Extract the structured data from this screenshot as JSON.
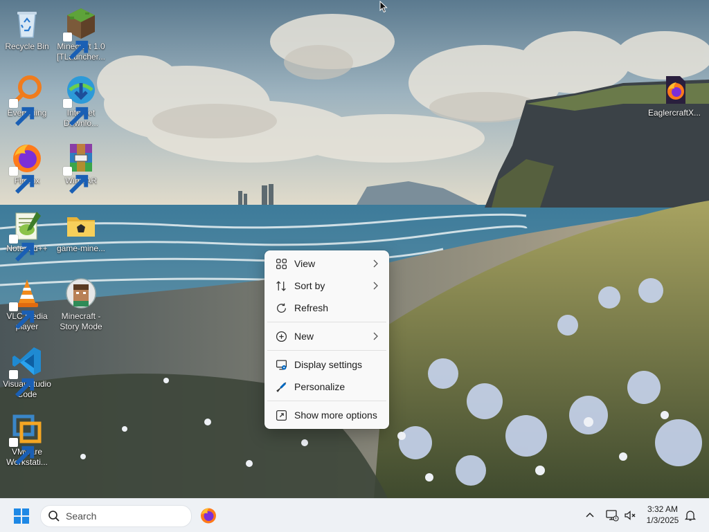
{
  "desktop": {
    "icons": [
      {
        "label": "Recycle Bin",
        "icon": "recycle-bin-icon"
      },
      {
        "label": "Minecraft 1.0 [TLauncher...",
        "icon": "minecraft-icon"
      },
      {
        "label": "Everything",
        "icon": "everything-search-icon"
      },
      {
        "label": "Internet Downlo...",
        "icon": "internet-download-manager-icon"
      },
      {
        "label": "Firefox",
        "icon": "firefox-icon"
      },
      {
        "label": "WinRAR",
        "icon": "winrar-icon"
      },
      {
        "label": "Notepad++",
        "icon": "notepad-plus-plus-icon"
      },
      {
        "label": "game-mine...",
        "icon": "folder-icon"
      },
      {
        "label": "VLC media player",
        "icon": "vlc-icon"
      },
      {
        "label": "Minecraft - Story Mode",
        "icon": "minecraft-story-mode-icon"
      },
      {
        "label": "Visual Studio Code",
        "icon": "vscode-icon"
      },
      {
        "label": "VMware Workstati...",
        "icon": "vmware-icon"
      },
      {
        "label": "EaglercraftX...",
        "icon": "eaglercraft-firefox-icon"
      }
    ]
  },
  "context_menu": {
    "view": "View",
    "sort_by": "Sort by",
    "refresh": "Refresh",
    "new": "New",
    "display_settings": "Display settings",
    "personalize": "Personalize",
    "show_more_options": "Show more options"
  },
  "taskbar": {
    "search_placeholder": "Search",
    "time": "3:32 AM",
    "date": "1/3/2025"
  },
  "colors": {
    "accent": "#0067c0",
    "taskbar_bg": "#eef1f5",
    "menu_bg": "#f9f9f9"
  }
}
